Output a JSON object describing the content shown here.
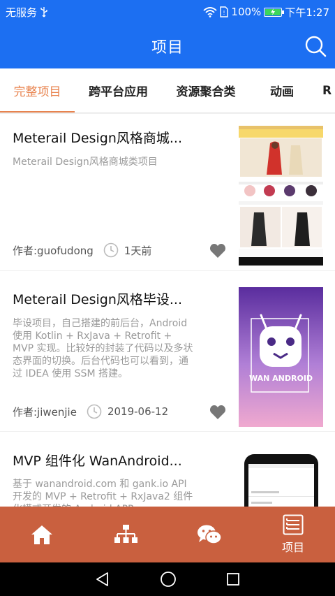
{
  "status": {
    "carrier": "无服务",
    "battery": "100%",
    "battery_level": 1.0,
    "time": "下午1:27"
  },
  "appbar": {
    "title": "项目"
  },
  "tabs": [
    "完整项目",
    "跨平台应用",
    "资源聚合类",
    "动画",
    "R"
  ],
  "active_tab": 0,
  "articles": [
    {
      "title": "Meterail Design风格商城...",
      "desc": "Meterail Design风格商城类项目",
      "author": "作者:guofudong",
      "time": "1天前"
    },
    {
      "title": "Meterail Design风格毕设...",
      "desc": "毕设项目，自己搭建的前后台，Android使用 Kotlin + RxJava + Retrofit + MVP 实现。比较好的封装了代码以及多状态界面的切换。后台代码也可以看到，通过 IDEA 使用 SSM 搭建。",
      "author": "作者:jiwenjie",
      "time": "2019-06-12",
      "thumb_text": "WAN ANDROID"
    },
    {
      "title": "MVP 组件化 WanAndroid...",
      "desc": "基于 wanandroid.com 和 gank.io API 开发的 MVP + Retrofit + RxJava2 组件化模式开发的 Android APP"
    }
  ],
  "bottom_nav": [
    {
      "icon": "home-icon",
      "label": ""
    },
    {
      "icon": "tree-icon",
      "label": ""
    },
    {
      "icon": "wechat-icon",
      "label": ""
    },
    {
      "icon": "project-icon",
      "label": "项目"
    }
  ],
  "colors": {
    "primary": "#1c6ff2",
    "accent": "#e8834e",
    "bottom_nav": "#c9603f"
  }
}
